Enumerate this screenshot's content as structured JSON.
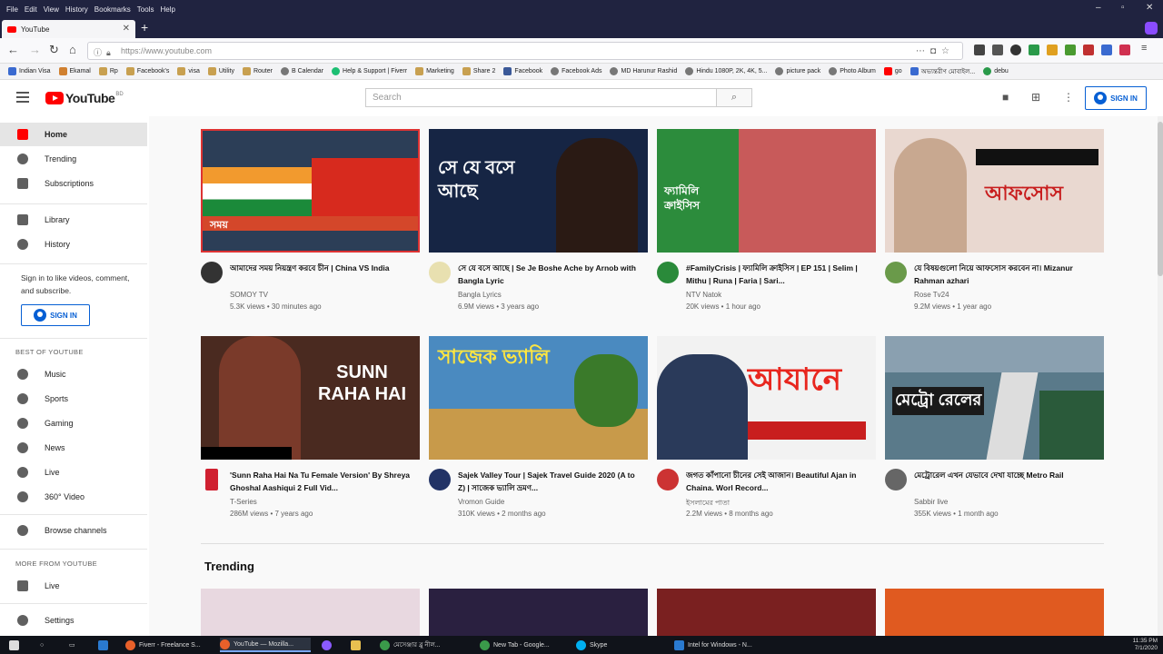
{
  "browser": {
    "menu": [
      "File",
      "Edit",
      "View",
      "History",
      "Bookmarks",
      "Tools",
      "Help"
    ],
    "tab_title": "YouTube",
    "url": "https://www.youtube.com",
    "bookmarks": [
      "Indian Visa",
      "Ekamal",
      "Rp",
      "Facebook's",
      "visa",
      "Utility",
      "Router",
      "B Calendar",
      "Help & Support | Fiverr",
      "Marketing",
      "Share 2",
      "Facebook",
      "Facebook Ads",
      "MD Harunur Rashid",
      "Hindu 1080P, 2K, 4K, 5...",
      "picture pack",
      "Photo Album",
      "go",
      "অভ্যন্তরীণ মোবাইল...",
      "debu"
    ]
  },
  "youtube": {
    "logo_text": "YouTube",
    "logo_country": "BD",
    "search_placeholder": "Search",
    "sign_in_label": "SIGN IN",
    "sidebar": {
      "items_top": [
        "Home",
        "Trending",
        "Subscriptions"
      ],
      "items_mid": [
        "Library",
        "History"
      ],
      "signin_text": "Sign in to like videos, comment, and subscribe.",
      "signin_button": "SIGN IN",
      "best_heading": "BEST OF YOUTUBE",
      "best_items": [
        "Music",
        "Sports",
        "Gaming",
        "News",
        "Live",
        "360° Video"
      ],
      "browse_channels": "Browse channels",
      "more_heading": "MORE FROM YOUTUBE",
      "more_items": [
        "Live"
      ],
      "settings": "Settings"
    },
    "videos": [
      {
        "title": "আমাদের সময় নিয়ন্ত্রণ করবে চীন | China VS India",
        "channel": "SOMOY TV",
        "stats": "5.3K views • 30 minutes ago",
        "thumb_text": "সময়",
        "thumb_bg": "#2c3e57",
        "avatar_color": "#333"
      },
      {
        "title": "সে যে বসে আছে | Se Je Boshe Ache by Arnob with Bangla Lyric",
        "channel": "Bangla Lyrics",
        "stats": "6.9M views • 3 years ago",
        "thumb_text": "সে যে বসে আছে",
        "thumb_bg": "#162544",
        "avatar_color": "#e8e0b0"
      },
      {
        "title": "#FamilyCrisis | ফ্যামিলি ক্রাইসিস | EP 151 | Selim | Mithu | Runa | Faria | Sari...",
        "channel": "NTV Natok",
        "stats": "20K views • 1 hour ago",
        "thumb_text": "ফ্যামিলি ক্রাইসিস",
        "thumb_bg": "#3a8a4a",
        "avatar_color": "#2a8a3a"
      },
      {
        "title": "যে বিষয়গুলো নিয়ে আফসোস করবেন না। Mizanur Rahman azhari",
        "channel": "Rose Tv24",
        "stats": "9.2M views • 1 year ago",
        "thumb_text": "আফসোস",
        "thumb_bg": "#e9d8d0",
        "avatar_color": "#6a9a4a"
      },
      {
        "title": "'Sunn Raha Hai Na Tu Female Version' By Shreya Ghoshal Aashiqui 2 Full Vid...",
        "channel": "T-Series",
        "stats": "286M views • 7 years ago",
        "thumb_text": "SUNN RAHA HAI",
        "thumb_bg": "#4a2a20",
        "avatar_color": "#d02030"
      },
      {
        "title": "Sajek Valley Tour | Sajek Travel Guide 2020 (A to Z) | সাজেক ভ্যালি ভ্রমণ...",
        "channel": "Vromon Guide",
        "stats": "310K views • 2 months ago",
        "thumb_text": "সাজেক ভ্যালি",
        "thumb_bg": "#4a8ac0",
        "avatar_color": "#223366"
      },
      {
        "title": "জগত কাঁপানো চীনের সেই আজান। Beautiful Ajan in Chaina. Worl Record...",
        "channel": "ইসলামের পাতা",
        "stats": "2.2M views • 8 months ago",
        "thumb_text": "আযানে",
        "thumb_bg": "#f2f2f2",
        "avatar_color": "#cc3333"
      },
      {
        "title": "মেট্রোরেল এখন যেভাবে দেখা যাচ্ছে Metro Rail",
        "channel": "Sabbir live",
        "stats": "355K views • 1 month ago",
        "thumb_text": "মেট্রো রেলের",
        "thumb_bg": "#5a7a8a",
        "avatar_color": "#666"
      }
    ],
    "trending_heading": "Trending",
    "trending_thumbs": [
      "#e8d8e0",
      "#2a2040",
      "#7a2020",
      "#e05a20"
    ]
  },
  "taskbar": {
    "items": [
      "Fiverr - Freelance S...",
      "YouTube — Mozilla...",
      "",
      "",
      "মেসেঞ্জার ব্লু নীল...",
      "New Tab - Google...",
      "Skype",
      "Intel for Windows - N..."
    ],
    "clock_time": "11:35 PM",
    "clock_date": "7/1/2020"
  }
}
